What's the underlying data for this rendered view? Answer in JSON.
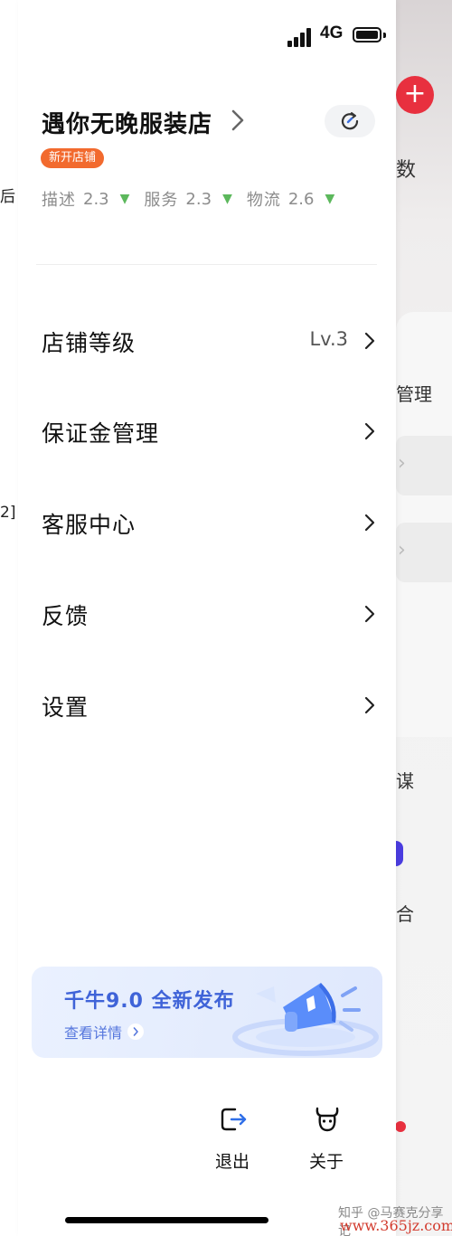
{
  "status_bar": {
    "network": "4G"
  },
  "background_app": {
    "left_fragments": [
      "后",
      "2]"
    ],
    "right_fragments": [
      "数",
      "管理",
      "谋",
      "合"
    ],
    "add_icon": "plus-icon"
  },
  "drawer": {
    "shop": {
      "name": "遇你无晚服装店",
      "tag": "新开店铺",
      "ratings": [
        {
          "label": "描述",
          "value": "2.3",
          "trend": "down"
        },
        {
          "label": "服务",
          "value": "2.3",
          "trend": "down"
        },
        {
          "label": "物流",
          "value": "2.6",
          "trend": "down"
        }
      ],
      "trend_color": "#5cb85c"
    },
    "menu": [
      {
        "label": "店铺等级",
        "value": "Lv.3"
      },
      {
        "label": "保证金管理",
        "value": ""
      },
      {
        "label": "客服中心",
        "value": ""
      },
      {
        "label": "反馈",
        "value": ""
      },
      {
        "label": "设置",
        "value": ""
      }
    ],
    "promo": {
      "title": "千牛9.0 全新发布",
      "link": "查看详情"
    },
    "actions": {
      "logout": "退出",
      "about": "关于"
    }
  },
  "watermark": {
    "text": "知乎 @马赛克分享记",
    "url": "www.365jz.com"
  },
  "colors": {
    "accent_red": "#e8303f",
    "tag_orange": "#f26a2e",
    "promo_blue": "#3f63d8"
  }
}
